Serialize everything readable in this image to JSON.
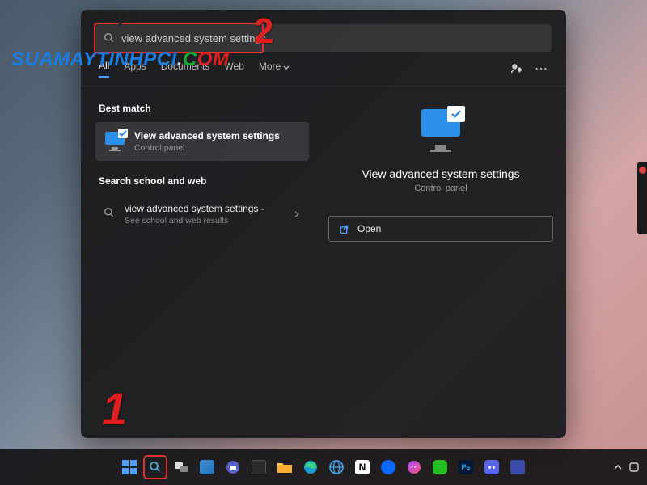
{
  "search": {
    "query": "view advanced system settings"
  },
  "tabs": {
    "all": "All",
    "apps": "Apps",
    "documents": "Documents",
    "web": "Web",
    "more": "More"
  },
  "left": {
    "best_match_hdr": "Best match",
    "best_match": {
      "title": "View advanced system settings",
      "sub": "Control panel"
    },
    "web_hdr": "Search school and web",
    "web_result": {
      "title": "view advanced system settings -",
      "sub": "See school and web results"
    }
  },
  "preview": {
    "title": "View advanced system settings",
    "sub": "Control panel",
    "open": "Open"
  },
  "callouts": {
    "one": "1",
    "two": "2"
  },
  "watermark": {
    "a": "SUAMAYTINH",
    "b": "PCI",
    "dot": ".",
    "c": "C",
    "d": "O",
    "e": "M"
  },
  "pci": "pci"
}
